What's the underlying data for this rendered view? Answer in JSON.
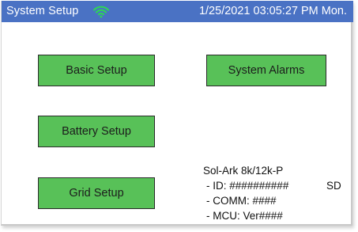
{
  "header": {
    "title": "System Setup",
    "datetime": "1/25/2021 03:05:27 PM Mon.",
    "wifi_icon": "wifi-icon",
    "wifi_color": "#2fd35a",
    "bar_color": "#4a72c4"
  },
  "buttons": {
    "basic_setup": "Basic Setup",
    "system_alarms": "System Alarms",
    "battery_setup": "Battery Setup",
    "grid_setup": "Grid Setup",
    "color": "#58c158"
  },
  "device_info": {
    "model": "Sol-Ark 8k/12k-P",
    "id": "- ID: ##########",
    "comm": "- COMM: ####",
    "mcu": "- MCU: Ver####",
    "sd": "SD"
  }
}
